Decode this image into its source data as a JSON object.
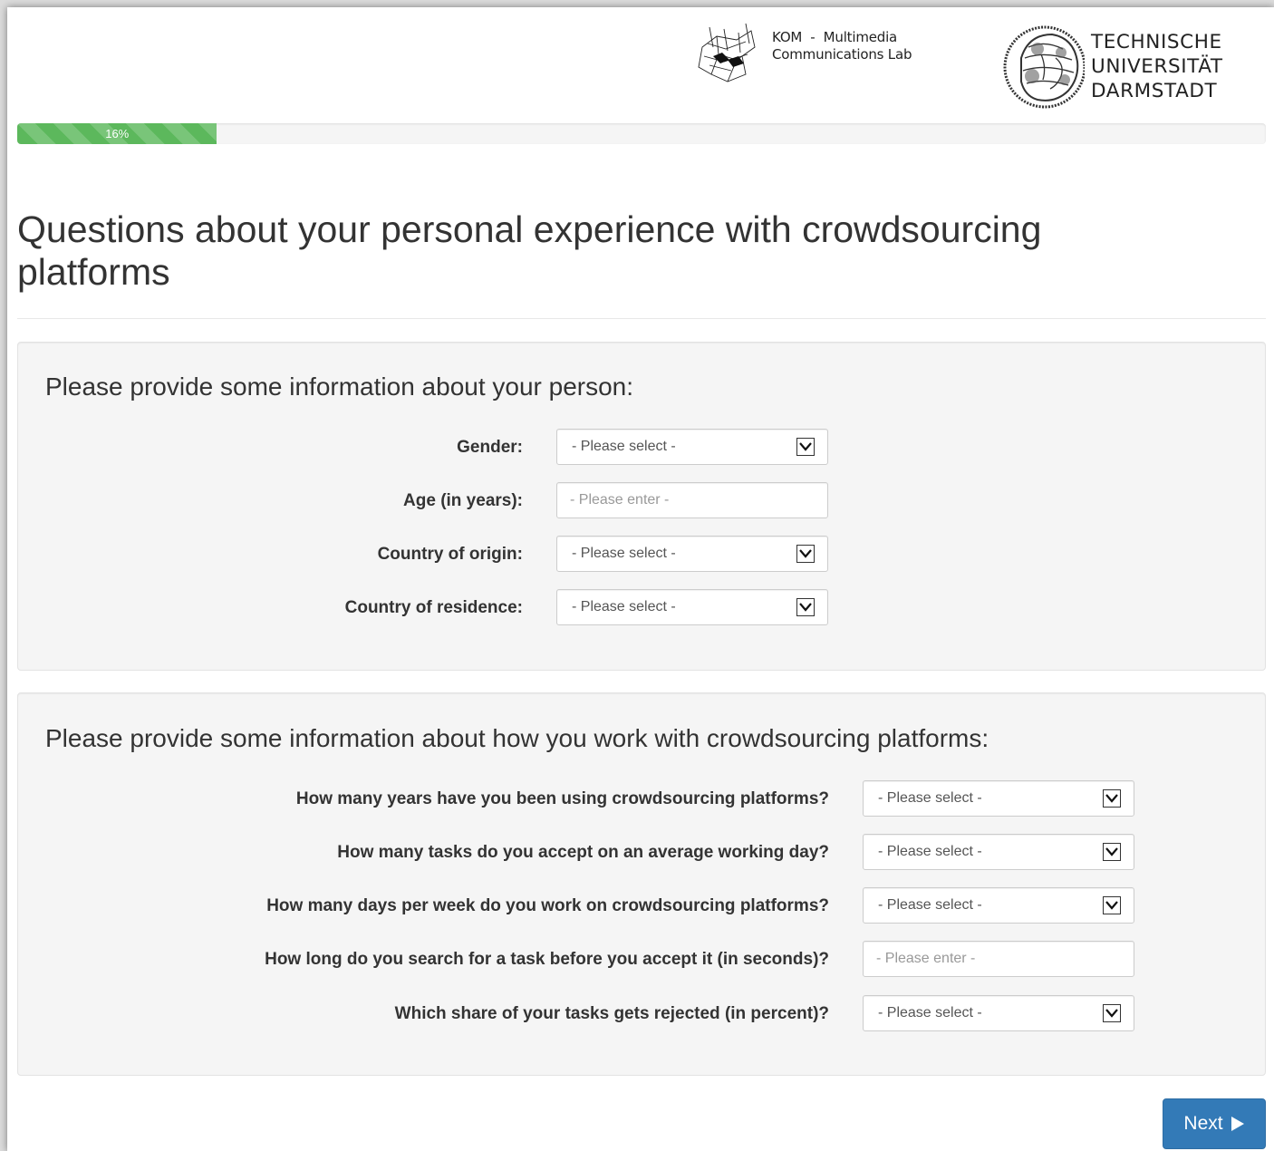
{
  "header": {
    "kom_line1": "KOM  -  Multimedia",
    "kom_line2": "Communications Lab",
    "tu_line1": "TECHNISCHE",
    "tu_line2": "UNIVERSITÄT",
    "tu_line3": "DARMSTADT"
  },
  "progress": {
    "value": 0.16,
    "label": "16%"
  },
  "page_title": "Questions about your personal experience with crowdsourcing platforms",
  "section_person": {
    "heading": "Please provide some information about your person:",
    "fields": [
      {
        "label": "Gender:",
        "type": "select",
        "value": "- Please select -"
      },
      {
        "label": "Age (in years):",
        "type": "input",
        "placeholder": "- Please enter -"
      },
      {
        "label": "Country of origin:",
        "type": "select",
        "value": "- Please select -"
      },
      {
        "label": "Country of residence:",
        "type": "select",
        "value": "- Please select -"
      }
    ]
  },
  "section_work": {
    "heading": "Please provide some information about how you work with crowdsourcing platforms:",
    "fields": [
      {
        "label": "How many years have you been using crowdsourcing platforms?",
        "type": "select",
        "value": "- Please select -"
      },
      {
        "label": "How many tasks do you accept on an average working day?",
        "type": "select",
        "value": "- Please select -"
      },
      {
        "label": "How many days per week do you work on crowdsourcing platforms?",
        "type": "select",
        "value": "- Please select -"
      },
      {
        "label": "How long do you search for a task before you accept it (in seconds)?",
        "type": "input",
        "placeholder": "- Please enter -"
      },
      {
        "label": "Which share of your tasks gets rejected (in percent)?",
        "type": "select",
        "value": "- Please select -"
      }
    ]
  },
  "next_button": {
    "label": "Next",
    "icon": "play-triangle-icon"
  },
  "colors": {
    "progress": "#5cb85c",
    "primary": "#337ab7",
    "well": "#f5f5f5"
  }
}
